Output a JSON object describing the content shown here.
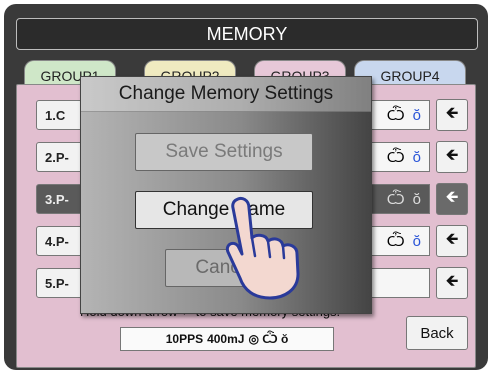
{
  "header": {
    "title": "MEMORY"
  },
  "tabs": [
    {
      "label": "GROUP1",
      "color": "#cfe7c8"
    },
    {
      "label": "GROUP2",
      "color": "#efeac0"
    },
    {
      "label": "GROUP3",
      "color": "#e7c8d8"
    },
    {
      "label": "GROUP4",
      "color": "#c8d7ee"
    }
  ],
  "rows": [
    {
      "label": "1.C",
      "icons": [
        "Ѽ",
        "ŏ"
      ]
    },
    {
      "label": "2.P-",
      "icons": [
        "Ѽ",
        "ŏ"
      ]
    },
    {
      "label": "3.P-",
      "icons": [
        "Ѽ",
        "ŏ"
      ]
    },
    {
      "label": "4.P-",
      "icons": [
        "Ѽ",
        "ŏ"
      ]
    },
    {
      "label": "5.P-",
      "icons": []
    }
  ],
  "arrow_glyph": "🡸",
  "hint": "Hold down arrow ⬅ to save memory settings.",
  "status": {
    "pps": "10PPS",
    "energy": "400mJ",
    "icons": "◎ Ѽ ŏ"
  },
  "back_label": "Back",
  "dialog": {
    "title": "Change Memory Settings",
    "save_label": "Save Settings",
    "change_label": "Change Name",
    "cancel_label": "Cancel"
  },
  "colors": {
    "panel": "#e2bfd0",
    "accent_blue": "#2a55d8"
  }
}
